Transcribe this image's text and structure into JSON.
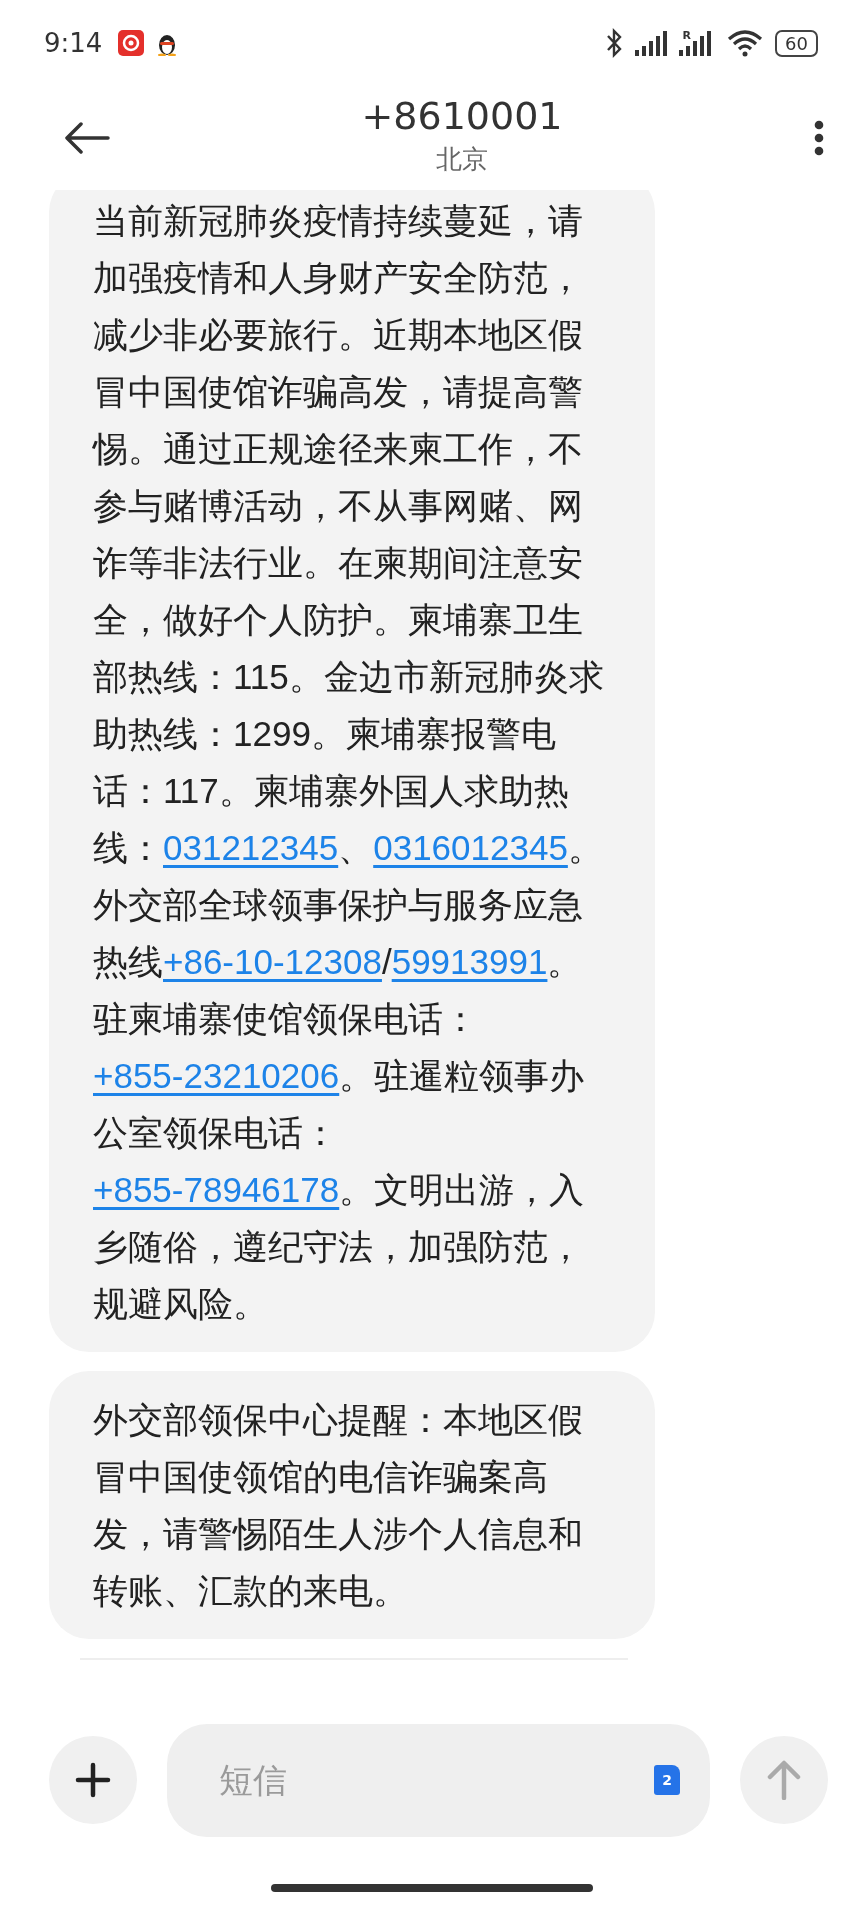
{
  "status_bar": {
    "time": "9:14",
    "battery": "60",
    "roaming_label": "R"
  },
  "header": {
    "title": "+8610001",
    "subtitle": "北京"
  },
  "messages": [
    {
      "segments": [
        {
          "kind": "text",
          "text": "当前新冠肺炎疫情持续蔓延，请加强疫情和人身财产安全防范，减少非必要旅行。近期本地区假冒中国使馆诈骗高发，请提高警惕。通过正规途径来柬工作，不参与赌博活动，不从事网赌、网诈等非法行业。在柬期间注意安全，做好个人防护。柬埔寨卫生部热线：115。金边市新冠肺炎求助热线：1299。柬埔寨报警电话：117。柬埔寨外国人求助热线："
        },
        {
          "kind": "link",
          "text": "031212345"
        },
        {
          "kind": "text",
          "text": "、"
        },
        {
          "kind": "link",
          "text": "0316012345"
        },
        {
          "kind": "text",
          "text": "。外交部全球领事保护与服务应急热线"
        },
        {
          "kind": "link",
          "text": "+86-10-12308"
        },
        {
          "kind": "text",
          "text": "/"
        },
        {
          "kind": "link",
          "text": "59913991"
        },
        {
          "kind": "text",
          "text": "。驻柬埔寨使馆领保电话："
        },
        {
          "kind": "link",
          "text": "+855-23210206"
        },
        {
          "kind": "text",
          "text": "。驻暹粒领事办公室领保电话："
        },
        {
          "kind": "link",
          "text": "+855-78946178"
        },
        {
          "kind": "text",
          "text": "。文明出游，入乡随俗，遵纪守法，加强防范，规避风险。"
        }
      ]
    },
    {
      "segments": [
        {
          "kind": "text",
          "text": "外交部领保中心提醒：本地区假冒中国使领馆的电信诈骗案高发，请警惕陌生人涉个人信息和转账、汇款的来电。"
        }
      ]
    }
  ],
  "composer": {
    "placeholder": "短信",
    "sim_badge": "2"
  }
}
